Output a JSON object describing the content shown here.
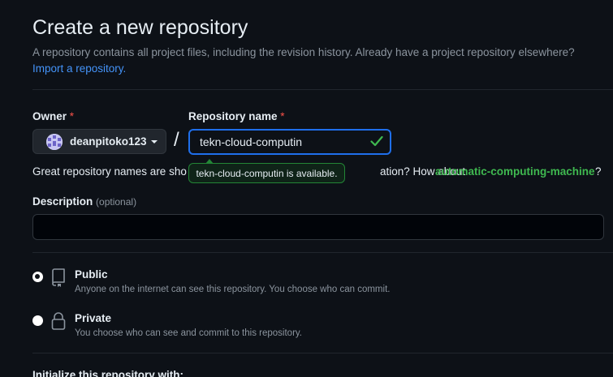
{
  "page": {
    "title": "Create a new repository",
    "intro_text": "A repository contains all project files, including the revision history. Already have a project repository elsewhere?",
    "import_link": "Import a repository."
  },
  "owner": {
    "label": "Owner",
    "required_mark": "*",
    "selected": "deanpitoko123"
  },
  "separator": "/",
  "repo_name": {
    "label": "Repository name",
    "required_mark": "*",
    "value": "tekn-cloud-computin",
    "availability_tooltip": "tekn-cloud-computin is available."
  },
  "hint": {
    "start": "Great repository names are sho",
    "end": "ation? How about",
    "suggestion": "automatic-computing-machine",
    "trailing": "?"
  },
  "description": {
    "label": "Description",
    "optional": "(optional)",
    "value": ""
  },
  "visibility": {
    "options": [
      {
        "title": "Public",
        "description": "Anyone on the internet can see this repository. You choose who can commit.",
        "icon": "repo-icon",
        "checked": true
      },
      {
        "title": "Private",
        "description": "You choose who can see and commit to this repository.",
        "icon": "lock-icon",
        "checked": false
      }
    ]
  },
  "initialize": {
    "label": "Initialize this repository with:"
  },
  "colors": {
    "background": "#0d1117",
    "link": "#4493f8",
    "success": "#3fb950",
    "focus_border": "#1f6feb",
    "required": "#f85149"
  }
}
